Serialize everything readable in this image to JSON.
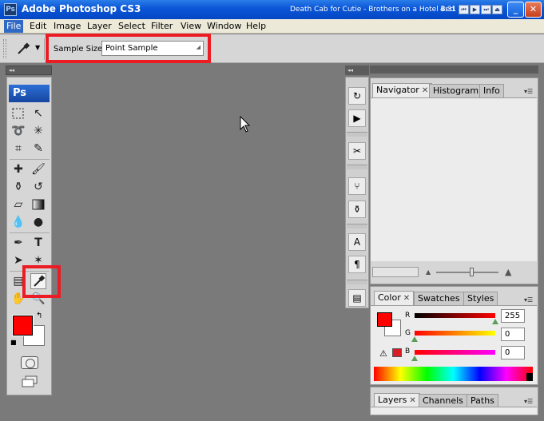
{
  "window": {
    "app_icon": "Ps",
    "title": "Adobe Photoshop CS3",
    "now_playing": "Death Cab for Cutie - Brothers on a Hotel Bed",
    "time": "4:31",
    "media_buttons": [
      "rewind-icon",
      "play-icon",
      "fast-forward-icon",
      "eject-icon"
    ],
    "window_buttons": [
      "minimize-icon",
      "maximize-icon",
      "close-icon"
    ]
  },
  "menu": {
    "items": [
      "File",
      "Edit",
      "Image",
      "Layer",
      "Select",
      "Filter",
      "View",
      "Window",
      "Help"
    ],
    "active": "File"
  },
  "options_bar": {
    "tool_icon": "eyedropper-icon",
    "sample_size_label": "Sample Size:",
    "sample_size_value": "Point Sample"
  },
  "tools_panel": {
    "logo": "Ps",
    "collapse_glyph": "◂◂",
    "rows": [
      [
        "marquee-icon",
        "move-icon"
      ],
      [
        "lasso-icon",
        "magic-wand-icon"
      ],
      [
        "crop-icon",
        "slice-icon"
      ],
      [
        "healing-brush-icon",
        "brush-icon"
      ],
      [
        "clone-stamp-icon",
        "history-brush-icon"
      ],
      [
        "eraser-icon",
        "gradient-icon"
      ],
      [
        "blur-icon",
        "dodge-icon"
      ],
      [
        "pen-icon",
        "type-icon"
      ],
      [
        "path-selection-icon",
        "custom-shape-icon"
      ],
      [
        "notes-icon",
        "eyedropper-icon"
      ],
      [
        "hand-icon",
        "zoom-icon"
      ]
    ],
    "selected_tool": "eyedropper-icon",
    "foreground_color": "#ff0000",
    "background_color": "#ffffff"
  },
  "dock": {
    "collapse_glyph": "◂◂",
    "icons": [
      "history-icon",
      "actions-icon",
      "tool-presets-icon",
      "layer-comps-icon",
      "clone-source-icon",
      "character-icon",
      "paragraph-icon",
      "info-doc-icon"
    ]
  },
  "navigator_panel": {
    "tabs": [
      "Navigator",
      "Histogram",
      "Info"
    ],
    "active_tab": "Navigator"
  },
  "color_panel": {
    "tabs": [
      "Color",
      "Swatches",
      "Styles"
    ],
    "active_tab": "Color",
    "channels": [
      {
        "label": "R",
        "value": "255"
      },
      {
        "label": "G",
        "value": "0"
      },
      {
        "label": "B",
        "value": "0"
      }
    ],
    "foreground_color": "#ff0000",
    "background_color": "#ffffff"
  },
  "layers_panel": {
    "tabs": [
      "Layers",
      "Channels",
      "Paths"
    ],
    "active_tab": "Layers"
  },
  "colors": {
    "highlight": "#ec1c24",
    "titlebar": "#0a55d6"
  }
}
